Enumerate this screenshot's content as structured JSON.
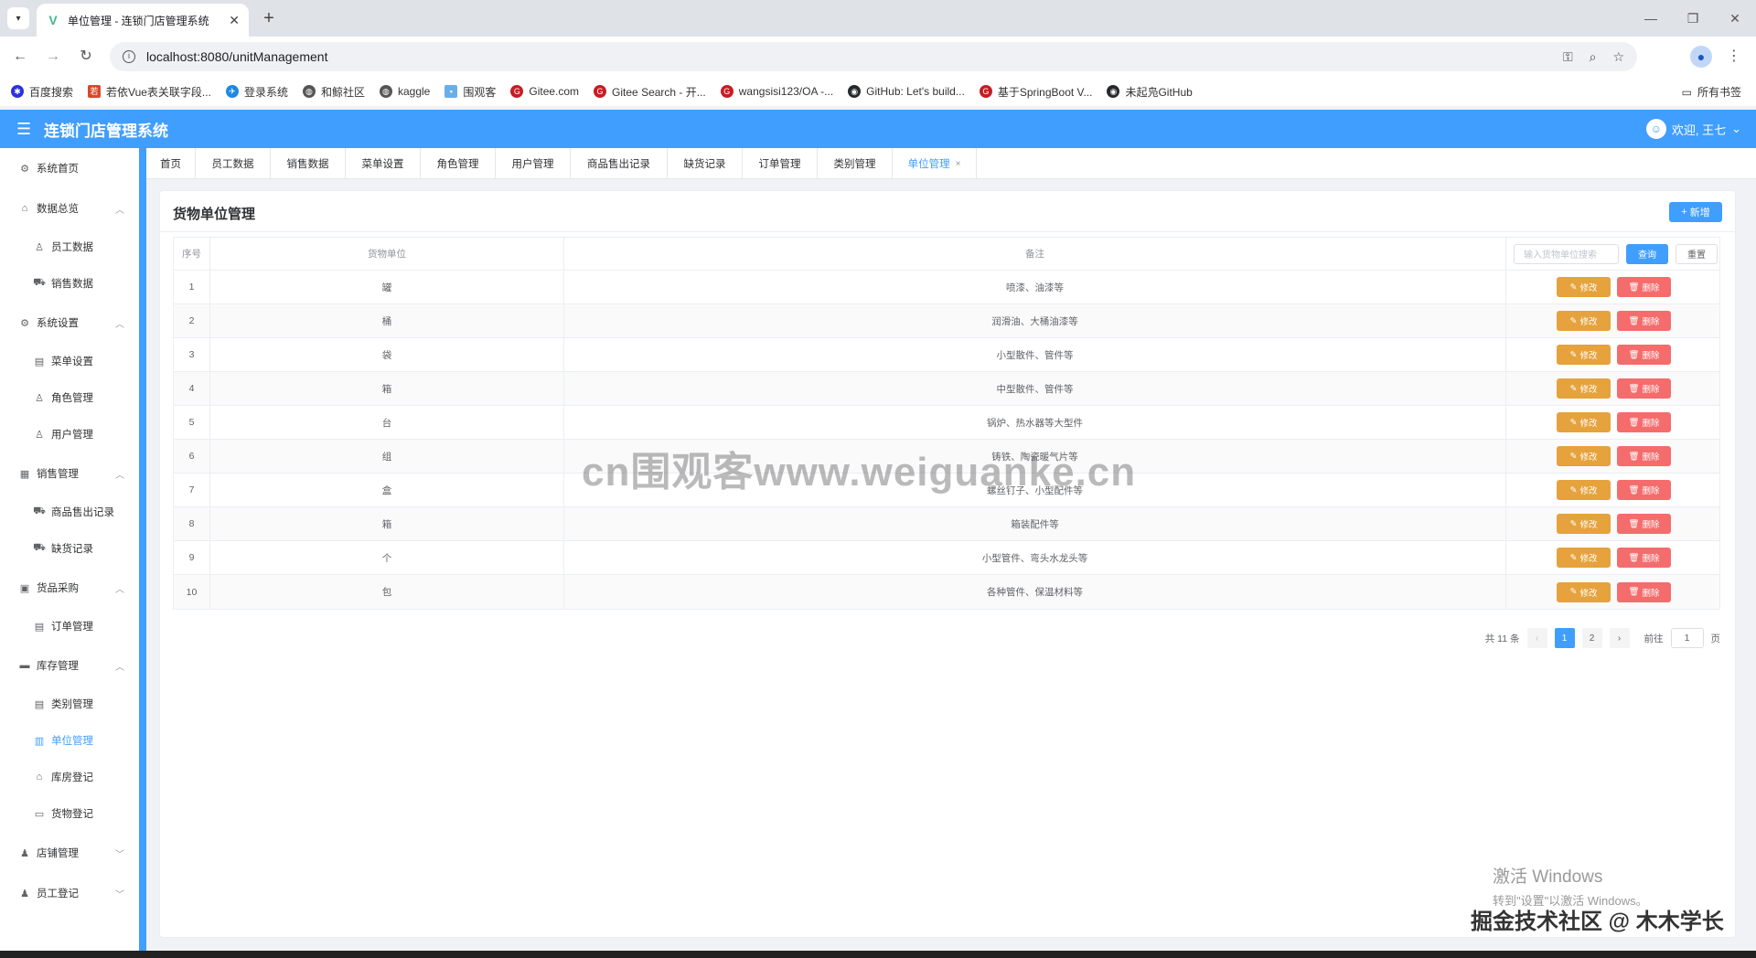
{
  "browser": {
    "tab_title": "单位管理 - 连锁门店管理系统",
    "url": "localhost:8080/unitManagement",
    "bookmarks": [
      "百度搜索",
      "若依Vue表关联字段...",
      "登录系统",
      "和鲸社区",
      "kaggle",
      "围观客",
      "Gitee.com",
      "Gitee Search - 开...",
      "wangsisi123/OA -...",
      "GitHub: Let's build...",
      "基于SpringBoot V...",
      "未起凫GitHub"
    ],
    "all_bookmarks": "所有书签"
  },
  "header": {
    "title": "连锁门店管理系统",
    "welcome": "欢迎, 王七"
  },
  "sidebar": {
    "items": [
      {
        "label": "系统首页"
      },
      {
        "label": "数据总览"
      },
      {
        "label": "员工数据"
      },
      {
        "label": "销售数据"
      },
      {
        "label": "系统设置"
      },
      {
        "label": "菜单设置"
      },
      {
        "label": "角色管理"
      },
      {
        "label": "用户管理"
      },
      {
        "label": "销售管理"
      },
      {
        "label": "商品售出记录"
      },
      {
        "label": "缺货记录"
      },
      {
        "label": "货品采购"
      },
      {
        "label": "订单管理"
      },
      {
        "label": "库存管理"
      },
      {
        "label": "类别管理"
      },
      {
        "label": "单位管理"
      },
      {
        "label": "库房登记"
      },
      {
        "label": "货物登记"
      },
      {
        "label": "店铺管理"
      },
      {
        "label": "员工登记"
      }
    ]
  },
  "tags": [
    {
      "label": "首页"
    },
    {
      "label": "员工数据"
    },
    {
      "label": "销售数据"
    },
    {
      "label": "菜单设置"
    },
    {
      "label": "角色管理"
    },
    {
      "label": "用户管理"
    },
    {
      "label": "商品售出记录"
    },
    {
      "label": "缺货记录"
    },
    {
      "label": "订单管理"
    },
    {
      "label": "类别管理"
    },
    {
      "label": "单位管理"
    }
  ],
  "main": {
    "title": "货物单位管理",
    "add_label": "新增",
    "table": {
      "headers": {
        "index": "序号",
        "unit": "货物单位",
        "note": "备注"
      },
      "search_placeholder": "输入货物单位搜索",
      "query_label": "查询",
      "reset_label": "重置",
      "edit_label": "修改",
      "delete_label": "删除",
      "rows": [
        {
          "index": "1",
          "unit": "罐",
          "note": "喷漆、油漆等"
        },
        {
          "index": "2",
          "unit": "桶",
          "note": "润滑油、大桶油漆等"
        },
        {
          "index": "3",
          "unit": "袋",
          "note": "小型散件、管件等"
        },
        {
          "index": "4",
          "unit": "箱",
          "note": "中型散件、管件等"
        },
        {
          "index": "5",
          "unit": "台",
          "note": "锅炉、热水器等大型件"
        },
        {
          "index": "6",
          "unit": "组",
          "note": "铸铁、陶瓷暖气片等"
        },
        {
          "index": "7",
          "unit": "盒",
          "note": "螺丝钉子、小型配件等"
        },
        {
          "index": "8",
          "unit": "箱",
          "note": "箱装配件等"
        },
        {
          "index": "9",
          "unit": "个",
          "note": "小型管件、弯头水龙头等"
        },
        {
          "index": "10",
          "unit": "包",
          "note": "各种管件、保温材料等"
        }
      ]
    },
    "pager": {
      "total": "共 11 条",
      "pages": [
        "1",
        "2"
      ],
      "goto": "前往",
      "page_value": "1",
      "page_unit": "页"
    }
  },
  "overlay": {
    "watermark": "cn围观客www.weiguanke.cn",
    "activate_title": "激活 Windows",
    "activate_sub": "转到\"设置\"以激活 Windows。",
    "credit": "掘金技术社区 @ 木木学长"
  },
  "colors": {
    "primary": "#409eff",
    "warning": "#e6a23c",
    "danger": "#f56c6c"
  }
}
